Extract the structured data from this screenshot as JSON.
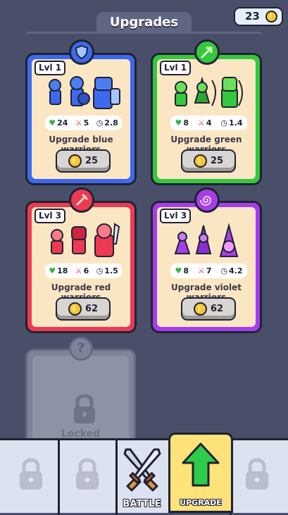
{
  "header": {
    "title": "Upgrades",
    "coins": "23"
  },
  "cards": [
    {
      "level": "Lvl 1",
      "health": "24",
      "attack": "5",
      "speed": "2.8",
      "title": "Upgrade blue warriors",
      "cost": "25",
      "color": "#3d69f0",
      "badge_icon": "shield-icon"
    },
    {
      "level": "Lvl 1",
      "health": "8",
      "attack": "4",
      "speed": "1.4",
      "title": "Upgrade green warriors",
      "cost": "25",
      "color": "#35c73d",
      "badge_icon": "arrow-icon"
    },
    {
      "level": "Lvl 3",
      "health": "18",
      "attack": "6",
      "speed": "1.5",
      "title": "Upgrade red warriors",
      "cost": "62",
      "color": "#ec3a52",
      "badge_icon": "sword-icon"
    },
    {
      "level": "Lvl 3",
      "health": "8",
      "attack": "7",
      "speed": "4.2",
      "title": "Upgrade violet warriors",
      "cost": "62",
      "color": "#a43ee9",
      "badge_icon": "spiral-icon"
    }
  ],
  "locked_card": {
    "badge": "?",
    "label": "Locked"
  },
  "nav": {
    "battle": "BATTLE",
    "upgrade": "UPGRADE"
  }
}
